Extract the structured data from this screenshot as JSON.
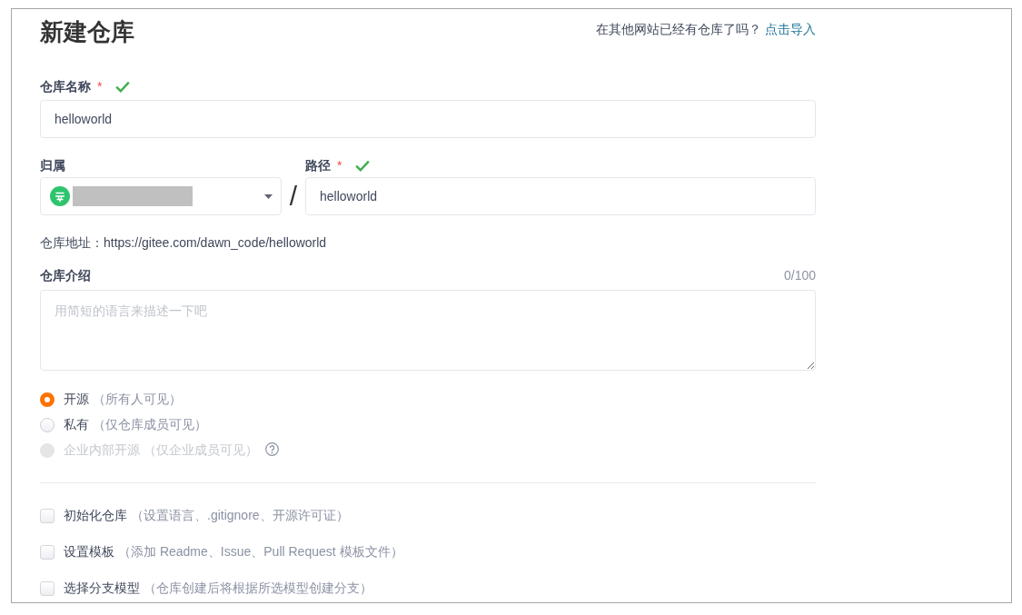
{
  "header": {
    "title": "新建仓库",
    "import_prompt": "在其他网站已经有仓库了吗？",
    "import_link": "点击导入"
  },
  "name_field": {
    "label": "仓库名称",
    "required_mark": "*",
    "valid": true,
    "value": "helloworld"
  },
  "owner_field": {
    "label": "归属",
    "name_redacted": true
  },
  "path_separator": "/",
  "path_field": {
    "label": "路径",
    "required_mark": "*",
    "valid": true,
    "value": "helloworld"
  },
  "repo_address": "仓库地址：https://gitee.com/dawn_code/helloworld",
  "description_field": {
    "label": "仓库介绍",
    "counter": "0/100",
    "placeholder": "用简短的语言来描述一下吧"
  },
  "visibility_options": [
    {
      "label": "开源",
      "hint": "（所有人可见）",
      "selected": true,
      "disabled": false,
      "help": false
    },
    {
      "label": "私有",
      "hint": "（仅仓库成员可见）",
      "selected": false,
      "disabled": false,
      "help": false
    },
    {
      "label": "企业内部开源",
      "hint": "（仅企业成员可见）",
      "selected": false,
      "disabled": true,
      "help": true
    }
  ],
  "init_options": [
    {
      "label": "初始化仓库",
      "hint": "（设置语言、.gitignore、开源许可证）",
      "checked": false
    },
    {
      "label": "设置模板",
      "hint": "（添加 Readme、Issue、Pull Request 模板文件）",
      "checked": false
    },
    {
      "label": "选择分支模型",
      "hint": "（仓库创建后将根据所选模型创建分支）",
      "checked": false
    }
  ]
}
